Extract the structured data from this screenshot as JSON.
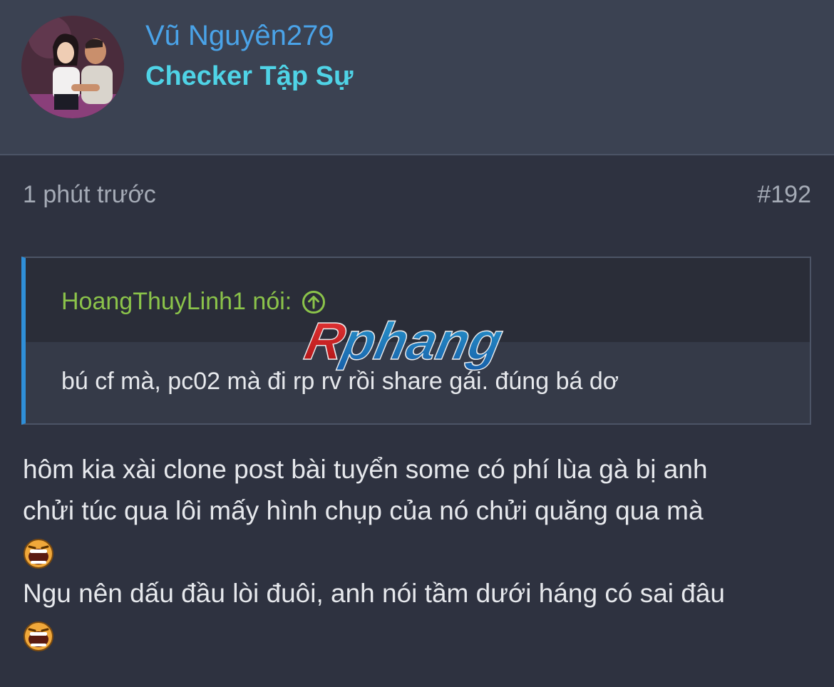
{
  "user": {
    "name": "Vũ Nguyên279",
    "title": "Checker Tập Sự"
  },
  "post": {
    "time": "1 phút trước",
    "number": "#192"
  },
  "quote": {
    "author": "HoangThuyLinh1 nói:",
    "text": "bú cf mà, pc02 mà đi rp rv rồi share gái. đúng bá dơ"
  },
  "watermark": {
    "text": "Rphang"
  },
  "message": {
    "lines": [
      "hôm kia xài clone post bài tuyển some có phí lùa gà bị anh",
      "chửi túc qua lôi mấy hình chụp của nó chửi quăng qua mà",
      "Ngu nên dấu đầu lòi đuôi, anh nói tầm dưới háng có sai đâu"
    ]
  },
  "icons": {
    "avatar": "user-avatar-photo",
    "quote_arrow": "arrow-up-circle-icon",
    "emoji": "laughing-emoji-icon"
  },
  "colors": {
    "username": "#4aa3e8",
    "user_title": "#4fd3e6",
    "quote_author": "#8bc34a",
    "quote_border": "#2f8fd8",
    "background": "#2e3240"
  }
}
